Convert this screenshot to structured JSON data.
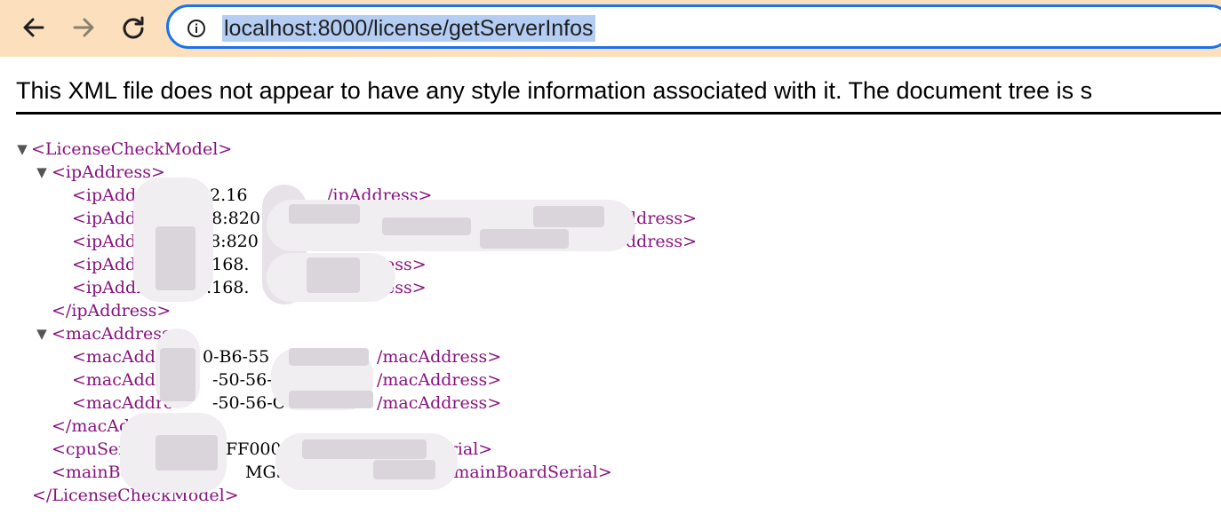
{
  "browser": {
    "url": "localhost:8000/license/getServerInfos",
    "toolbar_color": "#fce0bd",
    "focus_ring_color": "#1a73e8",
    "icons": [
      "back-arrow-icon",
      "forward-arrow-icon",
      "reload-icon",
      "info-icon"
    ]
  },
  "xml_viewer": {
    "notice": "This XML file does not appear to have any style information associated with it. The document tree is s",
    "tag_color": "#881280",
    "lines": {
      "l1": "<LicenseCheckModel>",
      "l2": "<ipAddress>",
      "l3a": "<ipAddre",
      "l3b": ">192.16",
      "l3c": "/ipAddress>",
      "l4a": "<ipAdd",
      "l4b": "408:820",
      "l4c": "ddress>",
      "l5a": "<ipAddre",
      "l5b": "08:820",
      "l5c": "ddress>",
      "l6a": "<ipAddre",
      "l6b": "2.168.",
      "l6c": "ess>",
      "l7a": "<ipAddres",
      "l7b": "2.168.",
      "l7c": "ess>",
      "l8": "</ipAddress>",
      "l9": "<macAddress>",
      "l10a": "<macAddre",
      "l10b": "0-B6-55",
      "l10c": "/macAddress>",
      "l11a": "<macAddre",
      "l11b": "-50-56-C0",
      "l11c": "/macAddress>",
      "l12a": "<macAddre",
      "l12b": "-50-56-C",
      "l12c": "/macAddress>",
      "l13": "</macAd",
      "l14a": "<cpuSer",
      "l14b": "BFF000",
      "l14c": "/cpuSerial>",
      "l15a": "<mainBoardS",
      "l15b": "MG5S0",
      "l15c": "/mainBoardSerial>",
      "l16": "</LicenseCheckModel>"
    }
  }
}
